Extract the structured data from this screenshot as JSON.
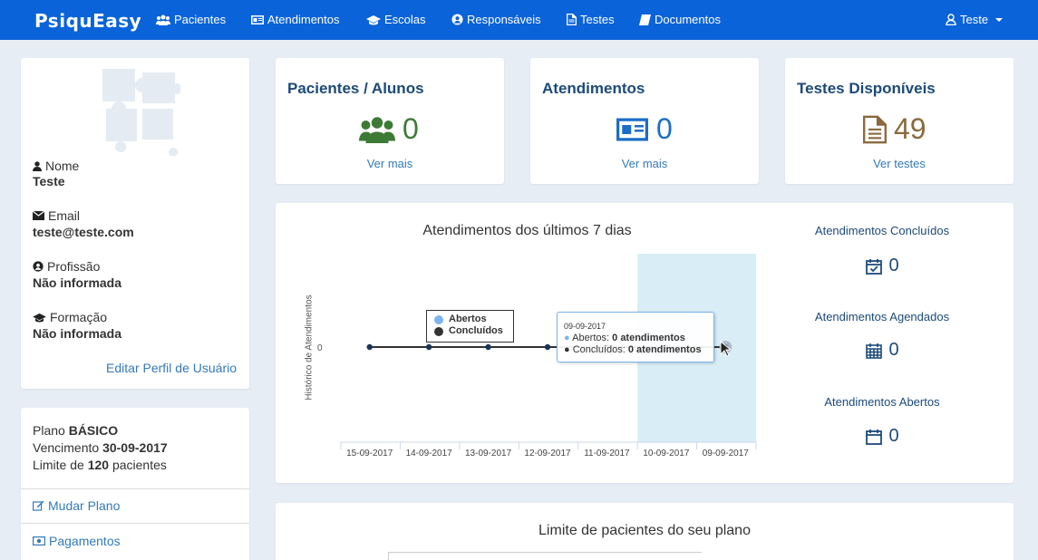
{
  "nav": {
    "brand": "PsiquEasy",
    "items": [
      "Pacientes",
      "Atendimentos",
      "Escolas",
      "Responsáveis",
      "Testes",
      "Documentos"
    ],
    "user": "Teste"
  },
  "profile": {
    "nome_label": "Nome",
    "nome": "Teste",
    "email_label": "Email",
    "email": "teste@teste.com",
    "profissao_label": "Profissão",
    "profissao": "Não informada",
    "formacao_label": "Formação",
    "formacao": "Não informada",
    "edit_link": "Editar Perfil de Usuário"
  },
  "plan": {
    "plano_prefix": "Plano",
    "plano": "BÁSICO",
    "venc_prefix": "Vencimento",
    "venc": "30-09-2017",
    "limite_prefix": "Limite de",
    "limite": "120",
    "limite_suffix": "pacientes",
    "mudar": "Mudar Plano",
    "pagamentos": "Pagamentos"
  },
  "stats": [
    {
      "title": "Pacientes / Alunos",
      "value": "0",
      "link": "Ver mais",
      "icon": "users-icon"
    },
    {
      "title": "Atendimentos",
      "value": "0",
      "link": "Ver mais",
      "icon": "id-card-icon"
    },
    {
      "title": "Testes Disponíveis",
      "value": "49",
      "link": "Ver testes",
      "icon": "document-icon"
    }
  ],
  "colors": {
    "nav": "#0a63d9",
    "green": "#3d7a36",
    "blue": "#1a6ec7",
    "brown": "#8a6a3c",
    "highlight": "#d9edf7"
  },
  "chart_data": {
    "type": "line",
    "title": "Atendimentos dos últimos 7 dias",
    "xlabel": "",
    "ylabel": "Histórico de Atendimentos",
    "categories": [
      "15-09-2017",
      "14-09-2017",
      "13-09-2017",
      "12-09-2017",
      "11-09-2017",
      "10-09-2017",
      "09-09-2017"
    ],
    "yticks": [
      "0"
    ],
    "series": [
      {
        "name": "Abertos",
        "values": [
          0,
          0,
          0,
          0,
          0,
          0,
          0
        ]
      },
      {
        "name": "Concluídos",
        "values": [
          0,
          0,
          0,
          0,
          0,
          0,
          0
        ]
      }
    ],
    "legend": "top-left",
    "highlighted": "09-09-2017",
    "tooltip": {
      "date": "09-09-2017",
      "abertos_label": "Abertos:",
      "abertos_value": "0 atendimentos",
      "concluidos_label": "Concluídos:",
      "concluidos_value": "0 atendimentos"
    }
  },
  "summary": [
    {
      "title": "Atendimentos Concluídos",
      "value": "0"
    },
    {
      "title": "Atendimentos Agendados",
      "value": "0"
    },
    {
      "title": "Atendimentos Abertos",
      "value": "0"
    }
  ],
  "limit_chart": {
    "title": "Limite de pacientes do seu plano"
  }
}
